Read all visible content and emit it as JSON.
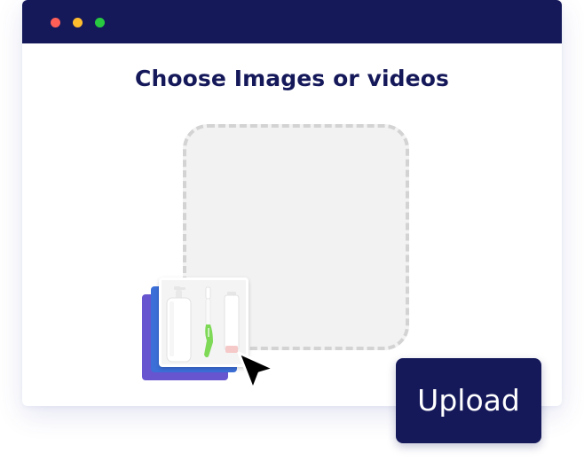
{
  "window": {
    "controls": [
      "close",
      "minimize",
      "maximize"
    ]
  },
  "main": {
    "title": "Choose Images or videos"
  },
  "dropzone": {
    "thumbnail_icon": "toiletries-product-image"
  },
  "upload_button": {
    "label": "Upload"
  },
  "colors": {
    "navy": "#15195a",
    "close": "#ff5f57",
    "minimize": "#ffbd2e",
    "maximize": "#28c840",
    "stack_purple": "#6655cf",
    "stack_blue": "#3c6fd8"
  },
  "icons": [
    "cursor-arrow-icon"
  ]
}
